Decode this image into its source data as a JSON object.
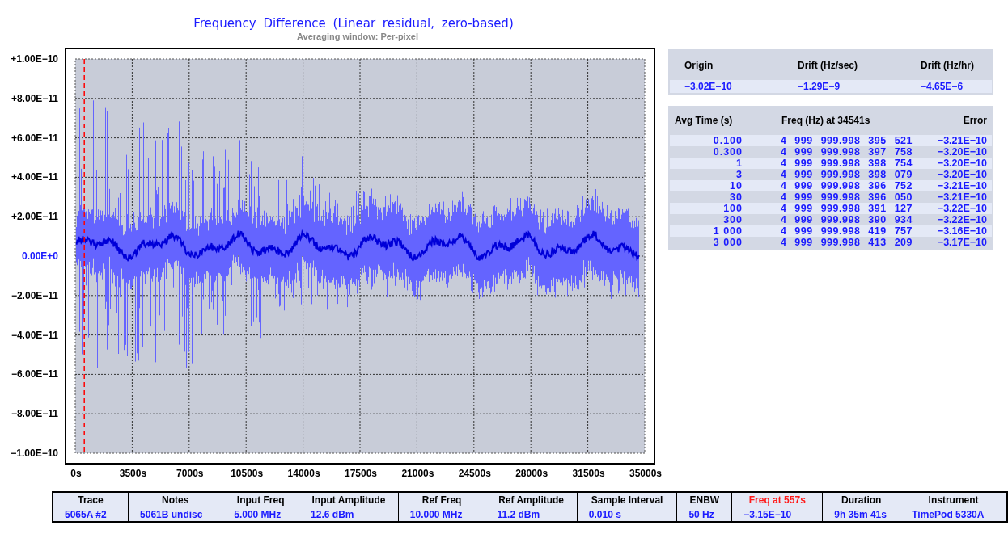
{
  "chart": {
    "title": "Frequency Difference (Linear residual, zero-based)",
    "subtitle": "Averaging window: Per-pixel",
    "y_labels": [
      {
        "text": "+1.00E−10",
        "kind": "tick"
      },
      {
        "text": "+8.00E−11",
        "kind": "tick"
      },
      {
        "text": "+6.00E−11",
        "kind": "tick"
      },
      {
        "text": "+4.00E−11",
        "kind": "tick"
      },
      {
        "text": "+2.00E−11",
        "kind": "tick"
      },
      {
        "text": "0.00E+0",
        "kind": "zero"
      },
      {
        "text": "−2.00E−11",
        "kind": "tick"
      },
      {
        "text": "−4.00E−11",
        "kind": "tick"
      },
      {
        "text": "−6.00E−11",
        "kind": "tick"
      },
      {
        "text": "−8.00E−11",
        "kind": "tick"
      },
      {
        "text": "−1.00E−10",
        "kind": "tick"
      }
    ],
    "x_labels": [
      "0s",
      "3500s",
      "7000s",
      "10500s",
      "14000s",
      "17500s",
      "21000s",
      "24500s",
      "28000s",
      "31500s",
      "35000s"
    ],
    "marker": {
      "level": 0.0159
    }
  },
  "drift": {
    "columns": [
      "Origin",
      "Drift (Hz/sec)",
      "Drift (Hz/hr)"
    ],
    "values": [
      "−3.02E−10",
      "−1.29E−9",
      "−4.65E−6"
    ]
  },
  "stability": {
    "columns": [
      "Avg Time (s)",
      "Freq (Hz) at 34541s",
      "Error"
    ],
    "rows": [
      {
        "avg_time": "0.100",
        "freq": "4 999 999.998 395 521",
        "error": "−3.21E−10"
      },
      {
        "avg_time": "0.300",
        "freq": "4 999 999.998 397 758",
        "error": "−3.20E−10"
      },
      {
        "avg_time": "1",
        "freq": "4 999 999.998 398 754",
        "error": "−3.20E−10"
      },
      {
        "avg_time": "3",
        "freq": "4 999 999.998 398 079",
        "error": "−3.20E−10"
      },
      {
        "avg_time": "10",
        "freq": "4 999 999.998 396 752",
        "error": "−3.21E−10"
      },
      {
        "avg_time": "30",
        "freq": "4 999 999.998 396 050",
        "error": "−3.21E−10"
      },
      {
        "avg_time": "100",
        "freq": "4 999 999.998 391 127",
        "error": "−3.22E−10"
      },
      {
        "avg_time": "300",
        "freq": "4 999 999.998 390 934",
        "error": "−3.22E−10"
      },
      {
        "avg_time": "1 000",
        "freq": "4 999 999.998 419 757",
        "error": "−3.16E−10"
      },
      {
        "avg_time": "3 000",
        "freq": "4 999 999.998 413 209",
        "error": "−3.17E−10"
      }
    ]
  },
  "summary": {
    "columns": [
      {
        "label": "Trace",
        "highlighted": false
      },
      {
        "label": "Notes",
        "highlighted": false
      },
      {
        "label": "Input Freq",
        "highlighted": false
      },
      {
        "label": "Input Amplitude",
        "highlighted": false
      },
      {
        "label": "Ref Freq",
        "highlighted": false
      },
      {
        "label": "Ref Amplitude",
        "highlighted": false
      },
      {
        "label": "Sample Interval",
        "highlighted": false
      },
      {
        "label": "ENBW",
        "highlighted": false
      },
      {
        "label": "Freq at 557s",
        "highlighted": true
      },
      {
        "label": "Duration",
        "highlighted": false
      },
      {
        "label": "Instrument",
        "highlighted": false
      }
    ],
    "values": [
      "5065A #2",
      "5061B undisc",
      "5.000 MHz",
      "12.6 dBm",
      "10.000 MHz",
      "11.2 dBm",
      "0.010 s",
      "50 Hz",
      "−3.15E−10",
      "9h 35m 41s",
      "TimePod 5330A"
    ]
  }
}
